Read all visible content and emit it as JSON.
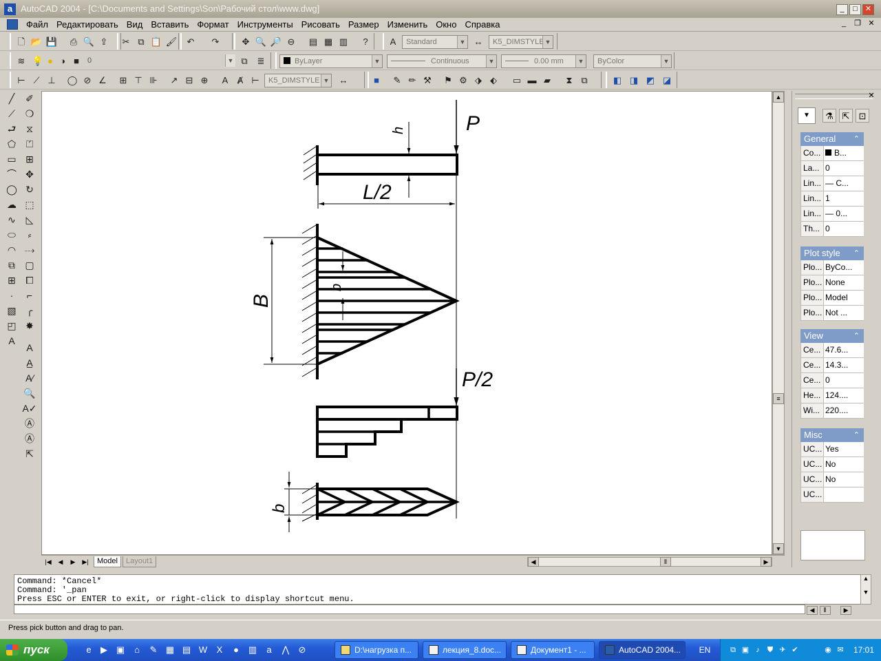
{
  "window": {
    "title": "AutoCAD 2004 - [C:\\Documents and Settings\\Son\\Рабочий стол\\www.dwg]",
    "app_icon": "a",
    "controls": [
      "minimize-icon",
      "maximize-icon",
      "close-icon"
    ]
  },
  "menu": {
    "items": [
      "Файл",
      "Редактировать",
      "Вид",
      "Вставить",
      "Формат",
      "Инструменты",
      "Рисовать",
      "Размер",
      "Изменить",
      "Окно",
      "Справка"
    ]
  },
  "toolbars": {
    "text_style": "Standard",
    "dim_style_top": "K5_DIMSTYLE",
    "layer": "0",
    "color": "ByLayer",
    "linetype": "Continuous",
    "lineweight": "0.00 mm",
    "plot_style": "ByColor",
    "dim_style_bottom": "K5_DIMSTYLE"
  },
  "drawing": {
    "labels": {
      "p": "P",
      "h": "h",
      "l2": "L/2",
      "b_upper": "B",
      "b_lower_inner": "b",
      "p2": "P/2",
      "b_bottom": "b"
    }
  },
  "tabs": {
    "model": "Model",
    "layout1": "Layout1"
  },
  "properties": {
    "general": {
      "title": "General",
      "rows": [
        {
          "k": "Co...",
          "v": "B..."
        },
        {
          "k": "La...",
          "v": "0"
        },
        {
          "k": "Lin...",
          "v": "— C..."
        },
        {
          "k": "Lin...",
          "v": "1"
        },
        {
          "k": "Lin...",
          "v": "— 0..."
        },
        {
          "k": "Th...",
          "v": "0"
        }
      ]
    },
    "plot_style": {
      "title": "Plot style",
      "rows": [
        {
          "k": "Plo...",
          "v": "ByCo..."
        },
        {
          "k": "Plo...",
          "v": "None"
        },
        {
          "k": "Plo...",
          "v": "Model"
        },
        {
          "k": "Plo...",
          "v": "Not ..."
        }
      ]
    },
    "view": {
      "title": "View",
      "rows": [
        {
          "k": "Ce...",
          "v": "47.6..."
        },
        {
          "k": "Ce...",
          "v": "14.3..."
        },
        {
          "k": "Ce...",
          "v": "0"
        },
        {
          "k": "He...",
          "v": "124...."
        },
        {
          "k": "Wi...",
          "v": "220...."
        }
      ]
    },
    "misc": {
      "title": "Misc",
      "rows": [
        {
          "k": "UC...",
          "v": "Yes"
        },
        {
          "k": "UC...",
          "v": "No"
        },
        {
          "k": "UC...",
          "v": "No"
        },
        {
          "k": "UC...",
          "v": ""
        }
      ]
    }
  },
  "command_line": {
    "lines": [
      "Command: *Cancel*",
      "Command: '_pan",
      "Press ESC or ENTER to exit, or right-click to display shortcut menu."
    ]
  },
  "status_bar": {
    "text": "Press pick button and drag to pan."
  },
  "taskbar": {
    "start_label": "пуск",
    "tasks": [
      {
        "label": "D:\\нагрузка п..."
      },
      {
        "label": "лекция_8.doc..."
      },
      {
        "label": "Документ1 - ..."
      },
      {
        "label": "AutoCAD 2004..."
      }
    ],
    "language": "EN",
    "clock": "17:01"
  },
  "colors": {
    "titlebar": "#a8a293",
    "palette_section": "#7f9bc8",
    "taskbar": "#245bd6",
    "start": "#2f8f2a"
  }
}
